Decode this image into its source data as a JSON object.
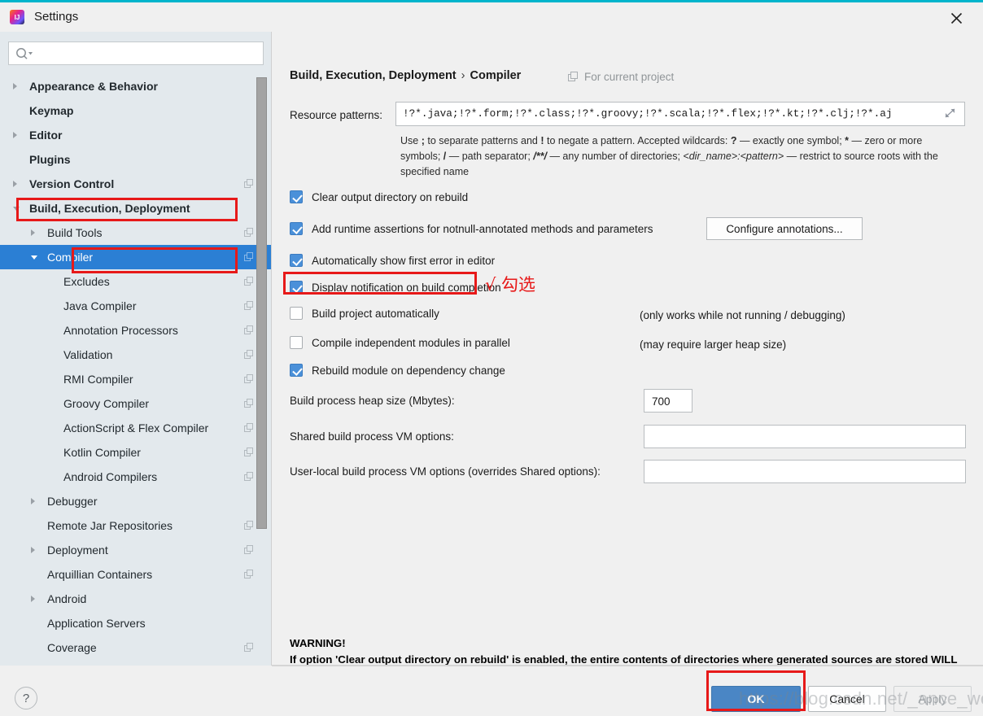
{
  "window": {
    "title": "Settings",
    "app_icon": "intellij-idea-icon",
    "close_icon": "close-icon",
    "accent_top_color": "#00b5cc"
  },
  "sidebar": {
    "search": {
      "placeholder": "",
      "value": "",
      "icon": "search-icon"
    },
    "items": [
      {
        "label": "Appearance & Behavior",
        "level": 0,
        "arrow": "right",
        "bold": true,
        "copy": false,
        "selected": false
      },
      {
        "label": "Keymap",
        "level": 0,
        "arrow": "none",
        "bold": true,
        "copy": false,
        "selected": false
      },
      {
        "label": "Editor",
        "level": 0,
        "arrow": "right",
        "bold": true,
        "copy": false,
        "selected": false
      },
      {
        "label": "Plugins",
        "level": 0,
        "arrow": "none",
        "bold": true,
        "copy": false,
        "selected": false
      },
      {
        "label": "Version Control",
        "level": 0,
        "arrow": "right",
        "bold": true,
        "copy": true,
        "selected": false
      },
      {
        "label": "Build, Execution, Deployment",
        "level": 0,
        "arrow": "down",
        "bold": true,
        "copy": false,
        "selected": false
      },
      {
        "label": "Build Tools",
        "level": 1,
        "arrow": "right",
        "bold": false,
        "copy": true,
        "selected": false
      },
      {
        "label": "Compiler",
        "level": 1,
        "arrow": "down",
        "bold": false,
        "copy": true,
        "selected": true
      },
      {
        "label": "Excludes",
        "level": 2,
        "arrow": "none",
        "bold": false,
        "copy": true,
        "selected": false
      },
      {
        "label": "Java Compiler",
        "level": 2,
        "arrow": "none",
        "bold": false,
        "copy": true,
        "selected": false
      },
      {
        "label": "Annotation Processors",
        "level": 2,
        "arrow": "none",
        "bold": false,
        "copy": true,
        "selected": false
      },
      {
        "label": "Validation",
        "level": 2,
        "arrow": "none",
        "bold": false,
        "copy": true,
        "selected": false
      },
      {
        "label": "RMI Compiler",
        "level": 2,
        "arrow": "none",
        "bold": false,
        "copy": true,
        "selected": false
      },
      {
        "label": "Groovy Compiler",
        "level": 2,
        "arrow": "none",
        "bold": false,
        "copy": true,
        "selected": false
      },
      {
        "label": "ActionScript & Flex Compiler",
        "level": 2,
        "arrow": "none",
        "bold": false,
        "copy": true,
        "selected": false
      },
      {
        "label": "Kotlin Compiler",
        "level": 2,
        "arrow": "none",
        "bold": false,
        "copy": true,
        "selected": false
      },
      {
        "label": "Android Compilers",
        "level": 2,
        "arrow": "none",
        "bold": false,
        "copy": true,
        "selected": false
      },
      {
        "label": "Debugger",
        "level": 1,
        "arrow": "right",
        "bold": false,
        "copy": false,
        "selected": false
      },
      {
        "label": "Remote Jar Repositories",
        "level": 1,
        "arrow": "none",
        "bold": false,
        "copy": true,
        "selected": false
      },
      {
        "label": "Deployment",
        "level": 1,
        "arrow": "right",
        "bold": false,
        "copy": true,
        "selected": false
      },
      {
        "label": "Arquillian Containers",
        "level": 1,
        "arrow": "none",
        "bold": false,
        "copy": true,
        "selected": false
      },
      {
        "label": "Android",
        "level": 1,
        "arrow": "right",
        "bold": false,
        "copy": false,
        "selected": false
      },
      {
        "label": "Application Servers",
        "level": 1,
        "arrow": "none",
        "bold": false,
        "copy": false,
        "selected": false
      },
      {
        "label": "Coverage",
        "level": 1,
        "arrow": "none",
        "bold": false,
        "copy": true,
        "selected": false
      }
    ]
  },
  "main": {
    "breadcrumb_parent": "Build, Execution, Deployment",
    "breadcrumb_sep": "›",
    "breadcrumb_current": "Compiler",
    "for_current_project": "For current project",
    "resource_patterns_label": "Resource patterns:",
    "resource_patterns_value": "!?*.java;!?*.form;!?*.class;!?*.groovy;!?*.scala;!?*.flex;!?*.kt;!?*.clj;!?*.aj",
    "resource_patterns_hint_1": "Use ",
    "resource_patterns_hint_semicolon": ";",
    "resource_patterns_hint_2": " to separate patterns and ",
    "resource_patterns_hint_bang": "!",
    "resource_patterns_hint_3": " to negate a pattern. Accepted wildcards: ",
    "resource_patterns_hint_q": "?",
    "resource_patterns_hint_4": " — exactly one symbol; ",
    "resource_patterns_hint_star": "*",
    "resource_patterns_hint_5": " — zero or more symbols; ",
    "resource_patterns_hint_slash": "/",
    "resource_patterns_hint_6": " — path separator; ",
    "resource_patterns_hint_dstar": "/**/",
    "resource_patterns_hint_7": " — any number of directories;  ",
    "resource_patterns_hint_dir": "<dir_name>:<pattern>",
    "resource_patterns_hint_8": " — restrict to source roots with the specified name",
    "expand_icon": "expand-icon",
    "checkboxes": [
      {
        "label": "Clear output directory on rebuild",
        "checked": true,
        "mnemonic": "l"
      },
      {
        "label": "Add runtime assertions for notnull-annotated methods and parameters",
        "checked": true,
        "mnemonic": "a"
      },
      {
        "label": "Automatically show first error in editor",
        "checked": true,
        "mnemonic": "e"
      },
      {
        "label": "Display notification on build completion",
        "checked": true,
        "mnemonic": ""
      },
      {
        "label": "Build project automatically",
        "checked": false,
        "mnemonic": ""
      },
      {
        "label": "Compile independent modules in parallel",
        "checked": false,
        "mnemonic": ""
      },
      {
        "label": "Rebuild module on dependency change",
        "checked": true,
        "mnemonic": ""
      }
    ],
    "configure_annotations_label": "Configure annotations...",
    "note_build_auto": "(only works while not running / debugging)",
    "note_parallel": "(may require larger heap size)",
    "heap_label": "Build process heap size (Mbytes):",
    "heap_value": "700",
    "shared_vm_label": "Shared build process VM options:",
    "shared_vm_value": "",
    "userlocal_vm_label": "User-local build process VM options (overrides Shared options):",
    "userlocal_vm_value": "",
    "warning_title": "WARNING!",
    "warning_body": "If option 'Clear output directory on rebuild' is enabled, the entire contents of directories where generated sources are stored WILL BE CLEARED on rebuild."
  },
  "footer": {
    "help_label": "?",
    "ok_label": "OK",
    "cancel_label": "Cancel",
    "apply_label": "Apply"
  },
  "annotations": {
    "note_text": "√ 勾选",
    "box_color": "#e71919",
    "watermark": "https://blog.csdn.net/_ance_welcome"
  }
}
